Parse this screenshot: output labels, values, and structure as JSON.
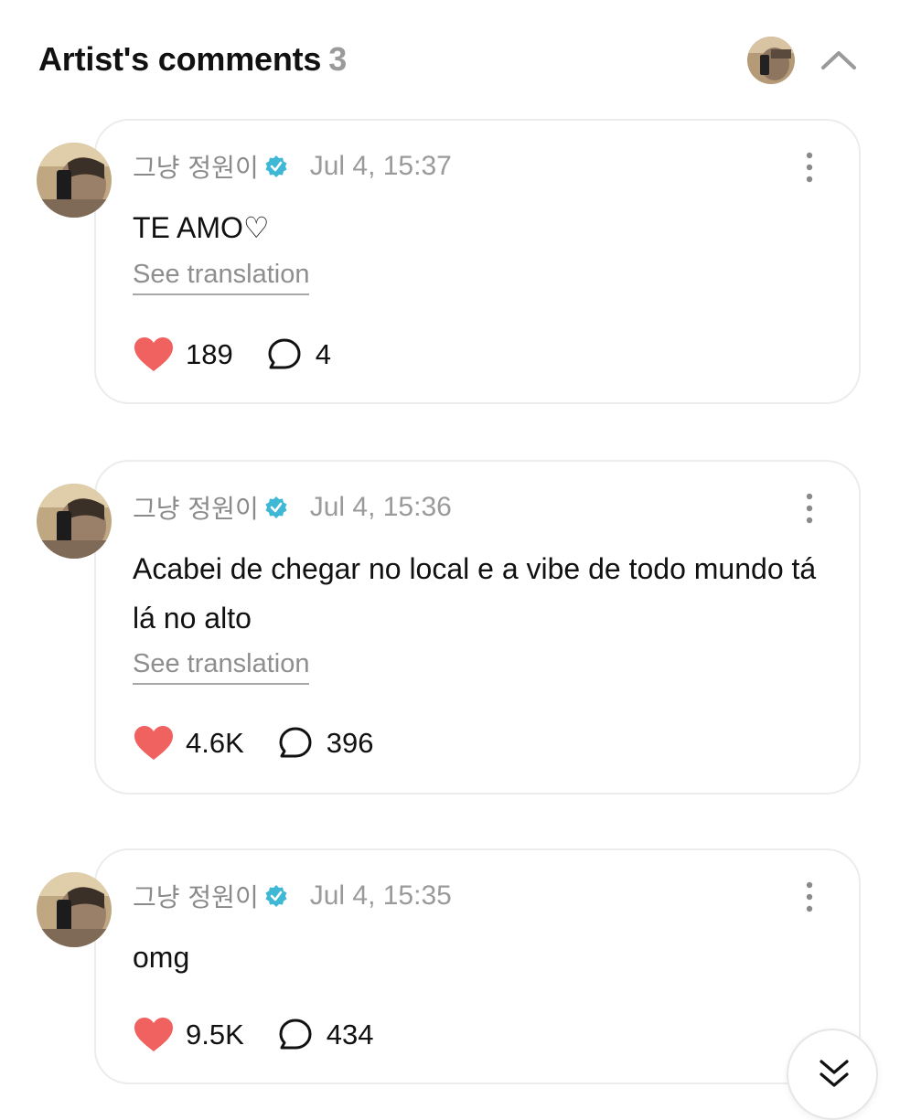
{
  "header": {
    "title": "Artist's comments",
    "count": "3",
    "avatar_icon": "user-avatar",
    "collapse_icon": "chevron-up-icon"
  },
  "comments": [
    {
      "author": "그냥 정원이",
      "verified": true,
      "timestamp": "Jul 4, 15:37",
      "text": "TE AMO♡",
      "see_translation": "See translation",
      "likes": "189",
      "replies": "4"
    },
    {
      "author": "그냥 정원이",
      "verified": true,
      "timestamp": "Jul 4, 15:36",
      "text": "Acabei de chegar no local e a vibe de todo mundo tá lá no alto",
      "see_translation": "See translation",
      "likes": "4.6K",
      "replies": "396"
    },
    {
      "author": "그냥 정원이",
      "verified": true,
      "timestamp": "Jul 4, 15:35",
      "text": "omg",
      "likes": "9.5K",
      "replies": "434"
    }
  ],
  "colors": {
    "heart": "#f0625f",
    "verified": "#3fb8d6",
    "muted_text": "#9a9a9a",
    "card_border": "#ececec"
  },
  "scroll_button_icon": "double-chevron-down-icon"
}
